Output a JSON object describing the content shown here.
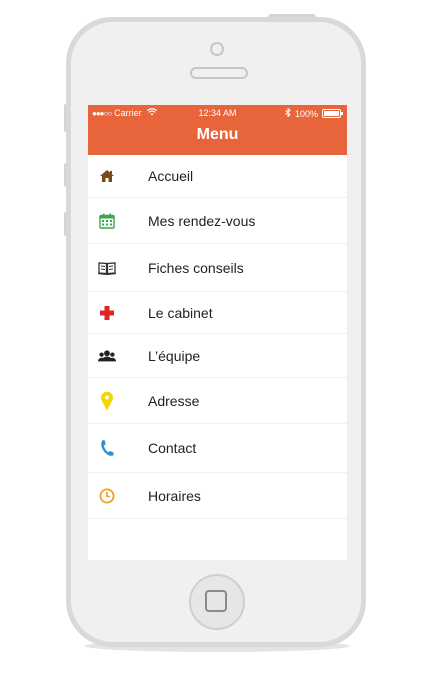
{
  "status_bar": {
    "carrier": "Carrier",
    "time": "12:34 AM",
    "battery": "100%"
  },
  "header": {
    "title": "Menu",
    "color": "#e8653b"
  },
  "menu": {
    "items": [
      {
        "label": "Accueil",
        "icon": "home-icon",
        "color": "#7a4a1e"
      },
      {
        "label": "Mes rendez-vous",
        "icon": "calendar-icon",
        "color": "#3aa64a"
      },
      {
        "label": "Fiches conseils",
        "icon": "book-icon",
        "color": "#333333"
      },
      {
        "label": "Le cabinet",
        "icon": "cross-icon",
        "color": "#e02424"
      },
      {
        "label": "L’équipe",
        "icon": "team-icon",
        "color": "#222222"
      },
      {
        "label": "Adresse",
        "icon": "map-pin-icon",
        "color": "#f2d600"
      },
      {
        "label": "Contact",
        "icon": "phone-icon",
        "color": "#2b8fd6"
      },
      {
        "label": "Horaires",
        "icon": "clock-icon",
        "color": "#f0a020"
      }
    ]
  }
}
